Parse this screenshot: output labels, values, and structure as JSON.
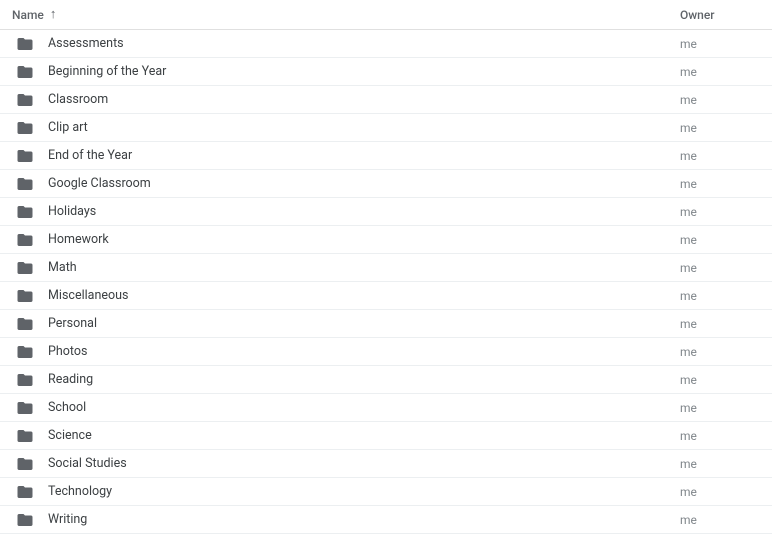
{
  "headers": {
    "name": "Name",
    "owner": "Owner",
    "sortIndicator": "↑"
  },
  "folders": [
    {
      "name": "Assessments",
      "owner": "me"
    },
    {
      "name": "Beginning of the Year",
      "owner": "me"
    },
    {
      "name": "Classroom",
      "owner": "me"
    },
    {
      "name": "Clip art",
      "owner": "me"
    },
    {
      "name": "End of the Year",
      "owner": "me"
    },
    {
      "name": "Google Classroom",
      "owner": "me"
    },
    {
      "name": "Holidays",
      "owner": "me"
    },
    {
      "name": "Homework",
      "owner": "me"
    },
    {
      "name": "Math",
      "owner": "me"
    },
    {
      "name": "Miscellaneous",
      "owner": "me"
    },
    {
      "name": "Personal",
      "owner": "me"
    },
    {
      "name": "Photos",
      "owner": "me"
    },
    {
      "name": "Reading",
      "owner": "me"
    },
    {
      "name": "School",
      "owner": "me"
    },
    {
      "name": "Science",
      "owner": "me"
    },
    {
      "name": "Social Studies",
      "owner": "me"
    },
    {
      "name": "Technology",
      "owner": "me"
    },
    {
      "name": "Writing",
      "owner": "me"
    }
  ]
}
